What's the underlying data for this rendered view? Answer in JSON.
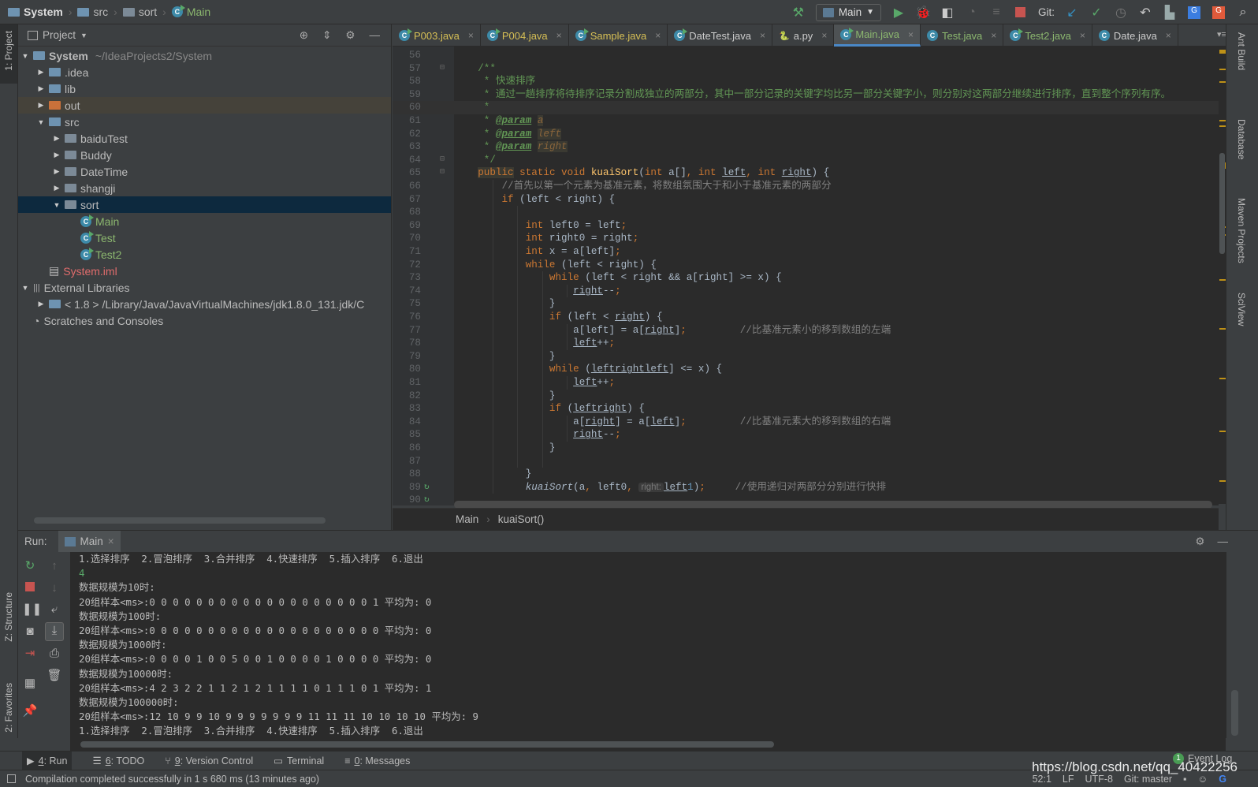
{
  "nav": {
    "project": "System",
    "crumbs": [
      "src",
      "sort",
      "Main"
    ]
  },
  "toolbar": {
    "run_config": "Main",
    "git_label": "Git:"
  },
  "project_panel": {
    "title": "Project",
    "tree": [
      {
        "label": "System",
        "suffix": "~/IdeaProjects2/System",
        "level": 0,
        "arrow": "down",
        "icon": "module",
        "bold": true
      },
      {
        "label": ".idea",
        "level": 1,
        "arrow": "right",
        "icon": "folder"
      },
      {
        "label": "lib",
        "level": 1,
        "arrow": "right",
        "icon": "folder"
      },
      {
        "label": "out",
        "level": 1,
        "arrow": "right",
        "icon": "folder-orange",
        "state": "hl"
      },
      {
        "label": "src",
        "level": 1,
        "arrow": "down",
        "icon": "folder"
      },
      {
        "label": "baiduTest",
        "level": 2,
        "arrow": "right",
        "icon": "package"
      },
      {
        "label": "Buddy",
        "level": 2,
        "arrow": "right",
        "icon": "package"
      },
      {
        "label": "DateTime",
        "level": 2,
        "arrow": "right",
        "icon": "package"
      },
      {
        "label": "shangji",
        "level": 2,
        "arrow": "right",
        "icon": "package"
      },
      {
        "label": "sort",
        "level": 2,
        "arrow": "down",
        "icon": "package",
        "state": "sel"
      },
      {
        "label": "Main",
        "level": 3,
        "icon": "class",
        "color": "#8cb86f"
      },
      {
        "label": "Test",
        "level": 3,
        "icon": "class",
        "color": "#8cb86f"
      },
      {
        "label": "Test2",
        "level": 3,
        "icon": "class",
        "color": "#8cb86f"
      },
      {
        "label": "System.iml",
        "level": 1,
        "icon": "iml",
        "color": "#e06c6c"
      },
      {
        "label": "External Libraries",
        "level": 0,
        "arrow": "down",
        "icon": "library"
      },
      {
        "label": "< 1.8 >  /Library/Java/JavaVirtualMachines/jdk1.8.0_131.jdk/C",
        "level": 1,
        "arrow": "right",
        "icon": "jdk"
      },
      {
        "label": "Scratches and Consoles",
        "level": 0,
        "icon": "scratch"
      }
    ]
  },
  "tabs": [
    {
      "label": "P003.java",
      "color": "yellow",
      "icon": "class-run"
    },
    {
      "label": "P004.java",
      "color": "yellow",
      "icon": "class-run"
    },
    {
      "label": "Sample.java",
      "color": "yellow",
      "icon": "class-run"
    },
    {
      "label": "DateTest.java",
      "color": "",
      "icon": "class-run"
    },
    {
      "label": "a.py",
      "color": "",
      "icon": "python"
    },
    {
      "label": "Main.java",
      "color": "green",
      "icon": "class-run",
      "active": true
    },
    {
      "label": "Test.java",
      "color": "green",
      "icon": "class"
    },
    {
      "label": "Test2.java",
      "color": "green",
      "icon": "class-run"
    },
    {
      "label": "Date.java",
      "color": "",
      "icon": "class-locked"
    }
  ],
  "tabs_overflow": "1",
  "code": {
    "current_line": 60,
    "lines": [
      {
        "n": 56,
        "segs": []
      },
      {
        "n": 57,
        "segs": [
          [
            "doc",
            "    /**"
          ]
        ]
      },
      {
        "n": 58,
        "segs": [
          [
            "doc",
            "     * 快速排序"
          ]
        ]
      },
      {
        "n": 59,
        "segs": [
          [
            "doc",
            "     * 通过一趟排序将待排序记录分割成独立的两部分，其中一部分记录的关键字均比另一部分关键字小，则分别对这两部分继续进行排序，直到整个序列有序。"
          ]
        ]
      },
      {
        "n": 60,
        "segs": [
          [
            "doc",
            "     *"
          ]
        ]
      },
      {
        "n": 61,
        "segs": [
          [
            "doc",
            "     * "
          ],
          [
            "tag",
            "@param"
          ],
          [
            "doc",
            " "
          ],
          [
            "prm",
            "a"
          ]
        ]
      },
      {
        "n": 62,
        "segs": [
          [
            "doc",
            "     * "
          ],
          [
            "tag",
            "@param"
          ],
          [
            "doc",
            " "
          ],
          [
            "prm",
            "left"
          ]
        ]
      },
      {
        "n": 63,
        "segs": [
          [
            "doc",
            "     * "
          ],
          [
            "tag",
            "@param"
          ],
          [
            "doc",
            " "
          ],
          [
            "prm",
            "right"
          ]
        ]
      },
      {
        "n": 64,
        "segs": [
          [
            "doc",
            "     */"
          ]
        ]
      },
      {
        "n": 65,
        "segs": [
          [
            "",
            "    "
          ],
          [
            "kw kwbg",
            "public"
          ],
          [
            "kw",
            " static void "
          ],
          [
            "fn",
            "kuaiSort"
          ],
          [
            "",
            "("
          ],
          [
            "kw",
            "int "
          ],
          [
            "",
            "a[]"
          ],
          [
            "kw",
            ", int "
          ],
          [
            "ul",
            "left"
          ],
          [
            "kw",
            ", int "
          ],
          [
            "ul",
            "right"
          ],
          [
            "",
            ") {"
          ]
        ]
      },
      {
        "n": 66,
        "segs": [
          [
            "cm",
            "        //首先以第一个元素为基准元素，将数组氛围大于和小于基准元素的两部分"
          ]
        ]
      },
      {
        "n": 67,
        "segs": [
          [
            "kw",
            "        if "
          ],
          [
            "",
            "(left < right) {"
          ]
        ]
      },
      {
        "n": 68,
        "segs": []
      },
      {
        "n": 69,
        "segs": [
          [
            "kw",
            "            int "
          ],
          [
            "",
            "left0 = left"
          ],
          [
            "kw",
            ";"
          ]
        ]
      },
      {
        "n": 70,
        "segs": [
          [
            "kw",
            "            int "
          ],
          [
            "",
            "right0 = right"
          ],
          [
            "kw",
            ";"
          ]
        ]
      },
      {
        "n": 71,
        "segs": [
          [
            "kw",
            "            int "
          ],
          [
            "",
            "x = a[left]"
          ],
          [
            "kw",
            ";"
          ]
        ]
      },
      {
        "n": 72,
        "segs": [
          [
            "kw",
            "            while "
          ],
          [
            "",
            "(left < right) {"
          ]
        ]
      },
      {
        "n": 73,
        "segs": [
          [
            "kw",
            "                while "
          ],
          [
            "",
            "(left < right && a[right] >= x) {"
          ]
        ]
      },
      {
        "n": 74,
        "segs": [
          [
            "",
            "                    "
          ],
          [
            "ul",
            "right"
          ],
          [
            "",
            "--"
          ],
          [
            "kw",
            ";"
          ]
        ]
      },
      {
        "n": 75,
        "segs": [
          [
            "",
            "                }"
          ]
        ]
      },
      {
        "n": 76,
        "segs": [
          [
            "kw",
            "                if "
          ],
          [
            "",
            "(left < "
          ],
          [
            "ul",
            "right"
          ],
          [
            "",
            ") {"
          ]
        ]
      },
      {
        "n": 77,
        "segs": [
          [
            "",
            "                    a[left] = a["
          ],
          [
            "ul",
            "right"
          ],
          [
            "",
            "]"
          ],
          [
            "kw",
            ";"
          ],
          [
            "cm",
            "         //比基准元素小的移到数组的左端"
          ]
        ]
      },
      {
        "n": 78,
        "segs": [
          [
            "",
            "                    "
          ],
          [
            "ul",
            "left"
          ],
          [
            "",
            "++"
          ],
          [
            "kw",
            ";"
          ]
        ]
      },
      {
        "n": 79,
        "segs": [
          [
            "",
            "                }"
          ]
        ]
      },
      {
        "n": 80,
        "segs": [
          [
            "kw",
            "                while "
          ],
          [
            "",
            "("
          ],
          [
            "ul",
            "left"
          ],
          [
            "",
            "",
            " < "
          ],
          [
            "",
            ""
          ],
          [
            "ul",
            "right"
          ],
          [
            "",
            "",
            " && a["
          ],
          [
            "ul",
            "left"
          ],
          [
            "",
            "] <= x) {"
          ]
        ]
      },
      {
        "n": 81,
        "segs": [
          [
            "",
            "                    "
          ],
          [
            "ul",
            "left"
          ],
          [
            "",
            "++"
          ],
          [
            "kw",
            ";"
          ]
        ]
      },
      {
        "n": 82,
        "segs": [
          [
            "",
            "                }"
          ]
        ]
      },
      {
        "n": 83,
        "segs": [
          [
            "kw",
            "                if "
          ],
          [
            "",
            "("
          ],
          [
            "ul",
            "left"
          ],
          [
            "",
            "",
            " < "
          ],
          [
            "ul",
            "right"
          ],
          [
            "",
            ") {"
          ]
        ]
      },
      {
        "n": 84,
        "segs": [
          [
            "",
            "                    a["
          ],
          [
            "ul",
            "right"
          ],
          [
            "",
            "] = a["
          ],
          [
            "ul",
            "left"
          ],
          [
            "",
            "]"
          ],
          [
            "kw",
            ";"
          ],
          [
            "cm",
            "         //比基准元素大的移到数组的右端"
          ]
        ]
      },
      {
        "n": 85,
        "segs": [
          [
            "",
            "                    "
          ],
          [
            "ul",
            "right"
          ],
          [
            "",
            "--"
          ],
          [
            "kw",
            ";"
          ]
        ]
      },
      {
        "n": 86,
        "segs": [
          [
            "",
            "                }"
          ]
        ]
      },
      {
        "n": 87,
        "segs": []
      },
      {
        "n": 88,
        "segs": [
          [
            "",
            "            }"
          ]
        ]
      },
      {
        "n": 89,
        "segs": [
          [
            "it",
            "            kuaiSort"
          ],
          [
            "",
            "(a"
          ],
          [
            "kw",
            ", "
          ],
          [
            "",
            "left0"
          ],
          [
            "kw",
            ", "
          ],
          [
            "hint",
            "right:"
          ],
          [
            "",
            "",
            " "
          ],
          [
            "ul",
            "left"
          ],
          [
            "",
            "",
            " - "
          ],
          [
            "num",
            "1"
          ],
          [
            "",
            ")"
          ],
          [
            "kw",
            ";"
          ],
          [
            "cm",
            "     //使用递归对两部分分别进行快排"
          ]
        ]
      },
      {
        "n": 90,
        "segs": []
      }
    ]
  },
  "editor_breadcrumb": [
    "Main",
    "kuaiSort()"
  ],
  "run": {
    "label": "Run:",
    "tab": "Main",
    "console": [
      {
        "text": "1.选择排序  2.冒泡排序  3.合并排序  4.快速排序  5.插入排序  6.退出"
      },
      {
        "text": "4",
        "input": true
      },
      {
        "text": "数据规模为10时:"
      },
      {
        "text": "20组样本<ms>:0 0 0 0 0 0 0 0 0 0 0 0 0 0 0 0 0 0 0 1 平均为: 0"
      },
      {
        "text": "数据规模为100时:"
      },
      {
        "text": "20组样本<ms>:0 0 0 0 0 0 0 0 0 0 0 0 0 0 0 0 0 0 0 0 平均为: 0"
      },
      {
        "text": "数据规模为1000时:"
      },
      {
        "text": "20组样本<ms>:0 0 0 0 1 0 0 5 0 0 1 0 0 0 0 1 0 0 0 0 平均为: 0"
      },
      {
        "text": "数据规模为10000时:"
      },
      {
        "text": "20组样本<ms>:4 2 3 2 2 1 1 2 1 2 1 1 1 1 0 1 1 1 0 1 平均为: 1"
      },
      {
        "text": "数据规模为100000时:"
      },
      {
        "text": "20组样本<ms>:12 10 9 9 10 9 9 9 9 9 9 9 11 11 11 10 10 10 10 平均为: 9"
      },
      {
        "text": "1.选择排序  2.冒泡排序  3.合并排序  4.快速排序  5.插入排序  6.退出"
      }
    ]
  },
  "left_stripe": {
    "project": "1: Project",
    "structure": "Z: Structure",
    "favorites": "2: Favorites"
  },
  "right_stripe": [
    "Ant Build",
    "Database",
    "Maven Projects",
    "SciView"
  ],
  "bottom_tools": [
    {
      "num": "4",
      "label": ": Run",
      "active": true,
      "icon": "play"
    },
    {
      "num": "6",
      "label": ": TODO",
      "icon": "list"
    },
    {
      "num": "9",
      "label": ": Version Control",
      "icon": "branch"
    },
    {
      "num": "",
      "label": "Terminal",
      "icon": "terminal"
    },
    {
      "num": "0",
      "label": ": Messages",
      "icon": "messages"
    }
  ],
  "event_log": {
    "count": "1",
    "label": "Event Log"
  },
  "status": {
    "message": "Compilation completed successfully in 1 s 680 ms (13 minutes ago)",
    "position": "52:1",
    "line_sep": "LF",
    "encoding": "UTF-8",
    "git": "Git: master"
  },
  "watermark": "https://blog.csdn.net/qq_40422256",
  "colors": {
    "background": "#2b2b2b",
    "panel": "#3c3f41",
    "keyword": "#cc7832",
    "doc_comment": "#629755",
    "comment": "#808080",
    "method": "#ffc66d",
    "selection": "#0d293e"
  }
}
